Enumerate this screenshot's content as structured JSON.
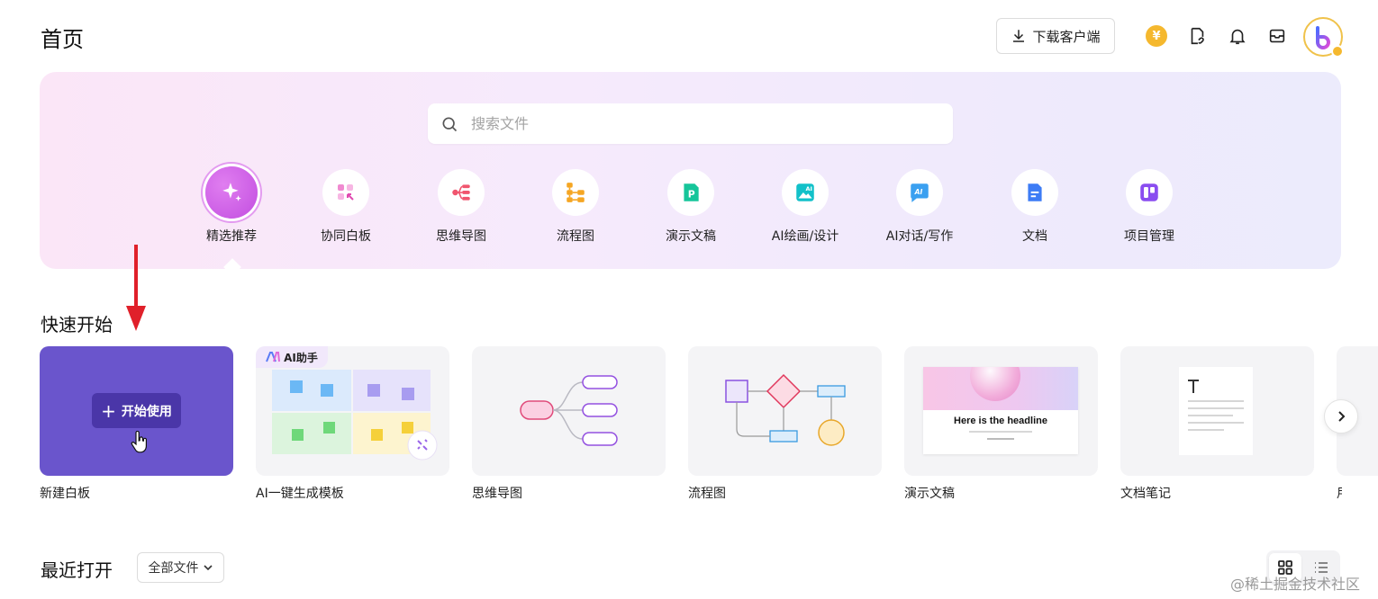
{
  "header": {
    "title": "首页",
    "download_label": "下载客户端",
    "coin_symbol": "¥"
  },
  "search": {
    "placeholder": "搜索文件"
  },
  "categories": [
    {
      "label": "精选推荐",
      "icon": "sparkle-icon",
      "active": true
    },
    {
      "label": "协同白板",
      "icon": "whiteboard-icon"
    },
    {
      "label": "思维导图",
      "icon": "mindmap-icon"
    },
    {
      "label": "流程图",
      "icon": "flowchart-icon"
    },
    {
      "label": "演示文稿",
      "icon": "presentation-icon"
    },
    {
      "label": "AI绘画/设计",
      "icon": "ai-painting-icon"
    },
    {
      "label": "AI对话/写作",
      "icon": "ai-chat-icon"
    },
    {
      "label": "文档",
      "icon": "document-icon"
    },
    {
      "label": "项目管理",
      "icon": "project-icon"
    }
  ],
  "quick_start": {
    "title": "快速开始",
    "start_label": "开始使用",
    "ai_tag": "AI助手",
    "slide_headline": "Here is the headline",
    "cards": [
      {
        "label": "新建白板"
      },
      {
        "label": "AI一键生成模板"
      },
      {
        "label": "思维导图"
      },
      {
        "label": "流程图"
      },
      {
        "label": "演示文稿"
      },
      {
        "label": "文档笔记"
      }
    ],
    "next_label_partial": "用"
  },
  "recent": {
    "title": "最近打开",
    "filter_label": "全部文件"
  },
  "watermark": "@稀土掘金技术社区",
  "colors": {
    "brand_purple": "#6a55cc",
    "button_purple": "#4a36a8",
    "coin_gold": "#f5b82e",
    "arrow_red": "#e0202a"
  }
}
